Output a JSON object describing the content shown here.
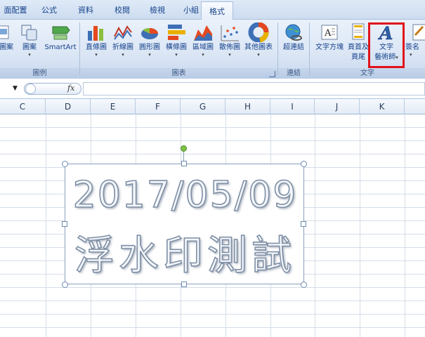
{
  "tabs": [
    {
      "label": "面配置"
    },
    {
      "label": "公式"
    },
    {
      "label": "資料"
    },
    {
      "label": "校閱"
    },
    {
      "label": "檢視"
    },
    {
      "label": "小組"
    },
    {
      "label": "格式"
    }
  ],
  "ribbon": {
    "groups": {
      "illustrations": {
        "label": "圖例",
        "buttons": [
          "圖案",
          "圖案",
          "SmartArt"
        ]
      },
      "charts": {
        "label": "圖表",
        "buttons": [
          "直條圖",
          "折線圖",
          "圓形圖",
          "橫條圖",
          "區域圖",
          "散佈圖",
          "其他圖表"
        ]
      },
      "links": {
        "label": "連結",
        "buttons": [
          "超連結"
        ]
      },
      "text": {
        "label": "文字",
        "buttons": [
          "文字方塊",
          "頁首及",
          "頁尾",
          "文字",
          "藝術師",
          "簽名"
        ]
      }
    }
  },
  "formula_bar": {
    "fx_label": "fx"
  },
  "columns": [
    "C",
    "D",
    "E",
    "F",
    "G",
    "H",
    "I",
    "J",
    "K"
  ],
  "wordart": {
    "line1": "2017/05/09",
    "line2": "浮水印測試"
  },
  "colors": {
    "highlight": "#e0121b",
    "rotation_handle": "#7cc243",
    "ribbon_text": "#15428b"
  }
}
